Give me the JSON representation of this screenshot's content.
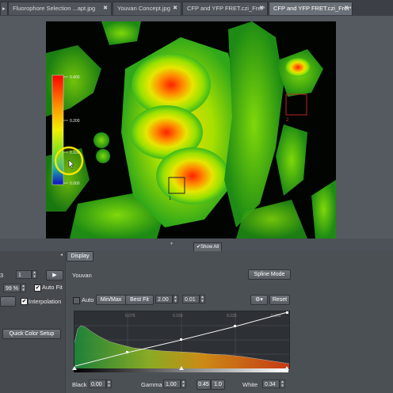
{
  "tabs": [
    {
      "label": "Fluorophore Selection ...apt.jpg"
    },
    {
      "label": "Youvan Concept.jpg"
    },
    {
      "label": "CFP and YFP FRET.czi_Fret*"
    },
    {
      "label": "CFP and YFP FRET.czi_Fret*"
    }
  ],
  "active_tab_index": 3,
  "viewer": {
    "colorbar_ticks": [
      "0.400",
      "0.200",
      "0.100",
      "0.000"
    ],
    "roi_labels": [
      "1",
      "2"
    ],
    "show_all_label": "Show All"
  },
  "left_panel": {
    "channel_value": "3",
    "index_value": "1",
    "zoom_value": "99 %",
    "auto_fit_label": "Auto Fit",
    "auto_fit_checked": true,
    "interpolation_label": "Interpolation",
    "interpolation_checked": true,
    "quick_color_label": "Quick Color Setup"
  },
  "display": {
    "tab_label": "Display",
    "lut_name": "Youvan",
    "spline_mode_label": "Spline Mode",
    "auto_label": "Auto",
    "auto_checked": false,
    "minmax_label": "Min/Max",
    "bestfit_label": "Best Fit",
    "bestfit_value1": "2.00",
    "bestfit_value2": "0.01",
    "reset_label": "Reset",
    "hist_ticks": [
      "0.075",
      "0.150",
      "0.225",
      "0.300"
    ],
    "black_label": "Black",
    "black_value": "0.00",
    "gamma_label": "Gamma",
    "gamma_value": "1.00",
    "gamma_v2": "0.45",
    "gamma_v3": "1.0",
    "white_label": "White",
    "white_value": "0.34"
  }
}
